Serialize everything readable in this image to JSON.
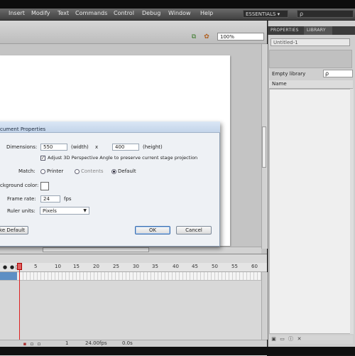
{
  "menubar": {
    "items": [
      "Insert",
      "Modify",
      "Text",
      "Commands",
      "Control",
      "Debug",
      "Window",
      "Help"
    ],
    "workspace": "ESSENTIALS ▾",
    "search_placeholder": "ρ"
  },
  "docbar": {
    "zoom": "100%"
  },
  "right_panel": {
    "tabs": [
      "PROPERTIES",
      "LIBRARY"
    ],
    "active_tab": "LIBRARY",
    "document_dropdown": "Untitled-1",
    "empty_library_text": "Empty library",
    "search_glyph": "ρ",
    "column_name": "Name"
  },
  "dialog": {
    "title": "cument Properties",
    "dimensions_label": "Dimensions:",
    "width_value": "550",
    "width_unit": "(width)",
    "times": "x",
    "height_value": "400",
    "height_unit": "(height)",
    "adjust_3d_label": "Adjust 3D Perspective Angle to preserve current stage projection",
    "adjust_3d_checked": true,
    "match_label": "Match:",
    "match_options": [
      "Printer",
      "Contents",
      "Default"
    ],
    "match_selected": "Default",
    "background_label": "ckground color:",
    "frame_rate_label": "Frame rate:",
    "frame_rate_value": "24",
    "fps_label": "fps",
    "ruler_units_label": "Ruler units:",
    "ruler_units_value": "Pixels",
    "make_default_label": "ke Default",
    "ok_label": "OK",
    "cancel_label": "Cancel"
  },
  "timeline": {
    "frame_numbers": [
      "5",
      "10",
      "15",
      "20",
      "25",
      "30",
      "35",
      "40",
      "45",
      "50",
      "55",
      "60"
    ],
    "footer_values": [
      "1",
      "24.00fps",
      "0.0s"
    ]
  },
  "colors": {
    "menubar": "#4f4f4f",
    "stage": "#ffffff",
    "dialog_bg": "#eef1f5",
    "playhead": "#dd2222",
    "layer_selected": "#5e8fc4"
  }
}
